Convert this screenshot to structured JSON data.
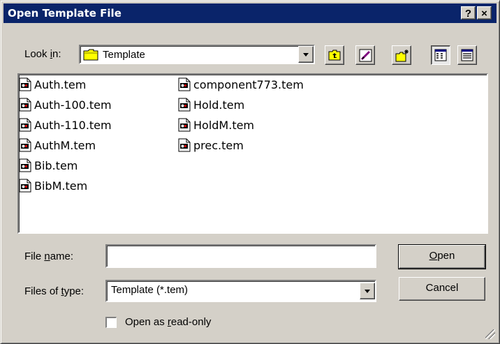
{
  "window": {
    "title": "Open Template File",
    "help_label": "?",
    "close_label": "×"
  },
  "look_in": {
    "label_pre": "Look ",
    "label_access": "i",
    "label_post": "n:",
    "value": "Template"
  },
  "toolbar": {
    "icons": [
      "up-one-level-icon",
      "desktop-icon",
      "new-folder-icon",
      "list-view-icon",
      "details-view-icon"
    ]
  },
  "files": [
    {
      "name": "Auth.tem"
    },
    {
      "name": "Auth-100.tem"
    },
    {
      "name": "Auth-110.tem"
    },
    {
      "name": "AuthM.tem"
    },
    {
      "name": "Bib.tem"
    },
    {
      "name": "BibM.tem"
    },
    {
      "name": "component773.tem"
    },
    {
      "name": "Hold.tem"
    },
    {
      "name": "HoldM.tem"
    },
    {
      "name": "prec.tem"
    }
  ],
  "file_name": {
    "label_pre": "File ",
    "label_access": "n",
    "label_post": "ame:",
    "value": ""
  },
  "file_type": {
    "label_pre": "Files of ",
    "label_access": "t",
    "label_post": "ype:",
    "value": "Template (*.tem)"
  },
  "buttons": {
    "open_access": "O",
    "open_rest": "pen",
    "cancel": "Cancel"
  },
  "readonly": {
    "label_pre": "Open as ",
    "label_access": "r",
    "label_post": "ead-only",
    "checked": false
  },
  "colors": {
    "title_bar": "#0a246a",
    "face": "#d4d0c8",
    "folder": "#ffff00"
  }
}
